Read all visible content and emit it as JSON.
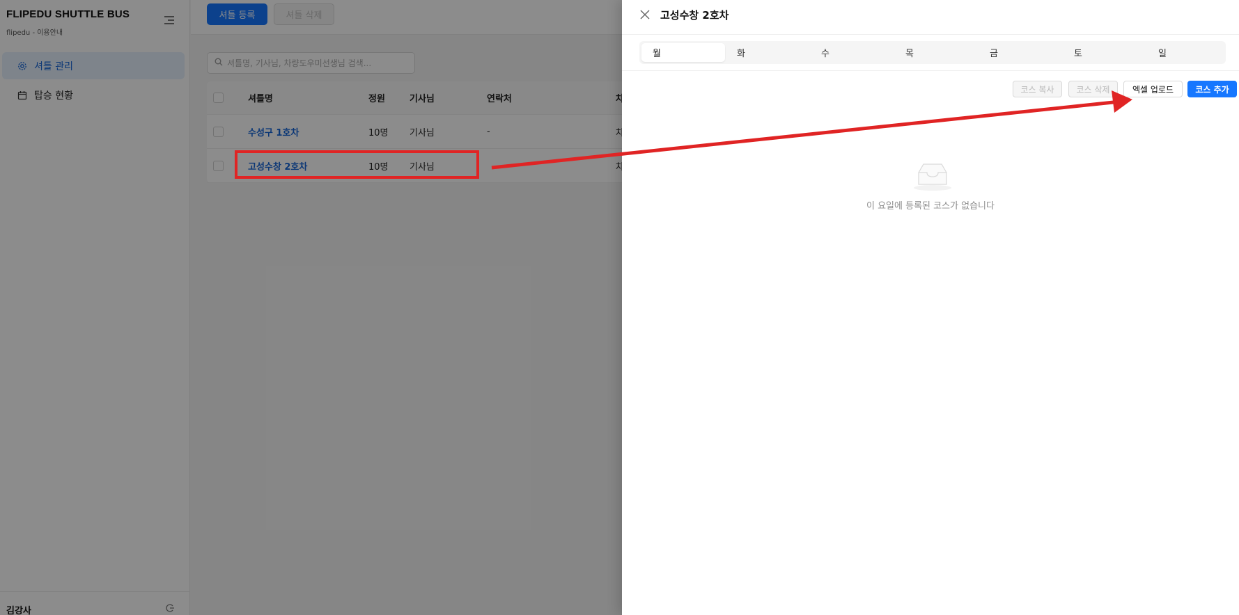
{
  "sidebar": {
    "brand_title": "FLIPEDU SHUTTLE BUS",
    "brand_subtitle": "flipedu - 이용안내",
    "items": [
      {
        "label": "셔틀 관리",
        "icon": "gear-icon",
        "active": true
      },
      {
        "label": "탑승 현황",
        "icon": "calendar-icon",
        "active": false
      }
    ],
    "user_name": "김강사"
  },
  "toolbar": {
    "register_label": "셔틀 등록",
    "delete_label": "셔틀 삭제"
  },
  "search": {
    "placeholder": "셔틀명, 기사님, 차량도우미선생님 검색..."
  },
  "table": {
    "columns": [
      "셔틀명",
      "정원",
      "기사님",
      "연락처",
      "차"
    ],
    "rows": [
      {
        "name": "수성구 1호차",
        "capacity": "10명",
        "driver": "기사님",
        "contact": "-",
        "extra": "차"
      },
      {
        "name": "고성수창 2호차",
        "capacity": "10명",
        "driver": "기사님",
        "contact": "",
        "extra": "차"
      }
    ]
  },
  "drawer": {
    "title": "고성수창 2호차",
    "tabs": [
      "월",
      "화",
      "수",
      "목",
      "금",
      "토",
      "일"
    ],
    "active_tab": "월",
    "buttons": {
      "copy_course": "코스 복사",
      "delete_course": "코스 삭제",
      "excel_upload": "엑셀 업로드",
      "add_course": "코스 추가"
    },
    "empty_message": "이 요일에 등록된 코스가 없습니다"
  },
  "colors": {
    "accent": "#1677ff",
    "link": "#1565d8",
    "annotation": "#e02424"
  }
}
